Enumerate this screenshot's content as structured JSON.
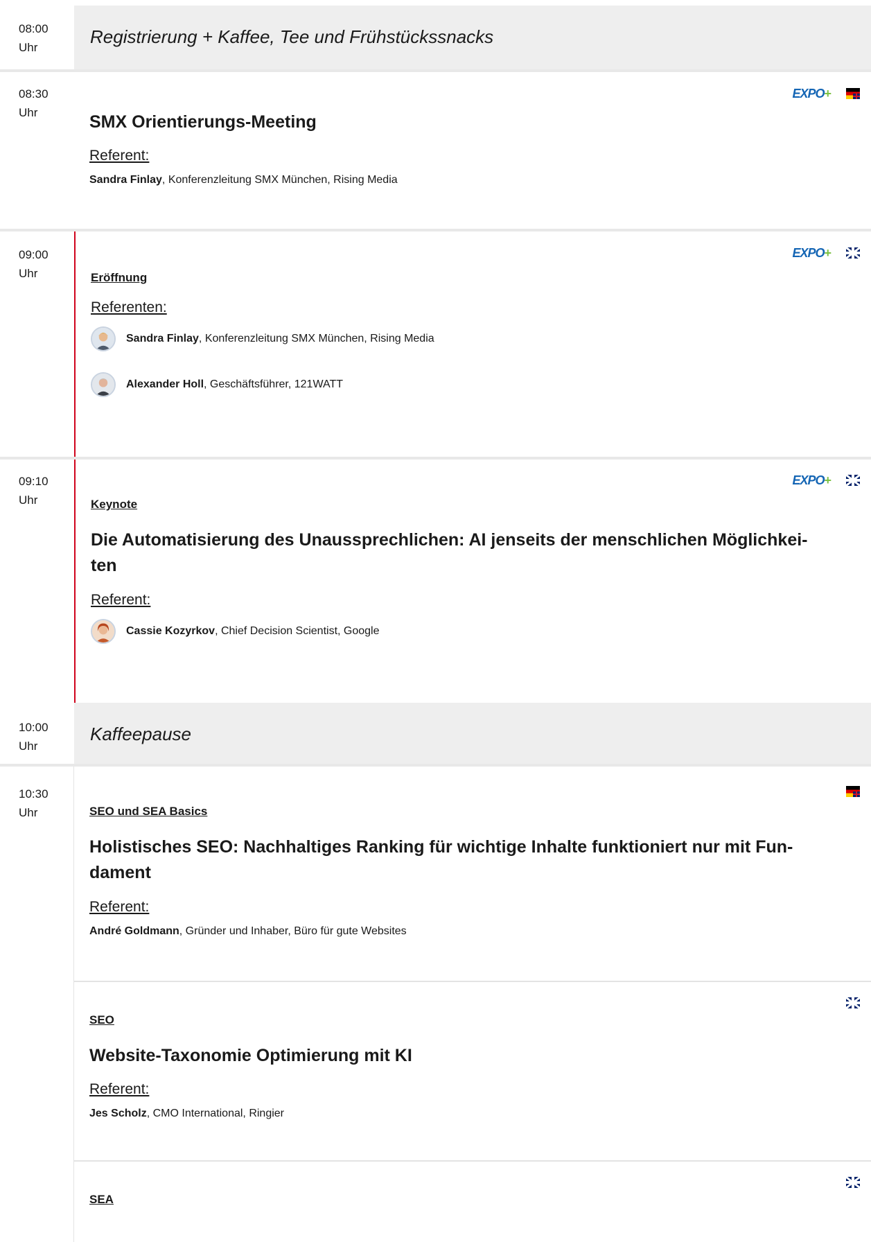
{
  "sessions": [
    {
      "time": "08:00",
      "unit": "Uhr",
      "break_title": "Registrierung + Kaffee, Tee und Frühstückssnacks"
    },
    {
      "time": "08:30",
      "unit": "Uhr",
      "expo_label": "EXPO",
      "expo_plus": "+",
      "title": "SMX Orientierungs-Meeting",
      "ref_label": "Referent:",
      "speakers": [
        {
          "name": "Sandra Finlay",
          "role": ", Konferenzleitung SMX München, Rising Media"
        }
      ]
    },
    {
      "time": "09:00",
      "unit": "Uhr",
      "expo_label": "EXPO",
      "expo_plus": "+",
      "track": "Eröffnung",
      "ref_label": "Referenten:",
      "speakers": [
        {
          "name": "Sandra Finlay",
          "role": ", Konferenzleitung SMX München, Rising Media"
        },
        {
          "name": "Alexander Holl",
          "role": ", Geschäftsführer, 121WATT"
        }
      ]
    },
    {
      "time": "09:10",
      "unit": "Uhr",
      "expo_label": "EXPO",
      "expo_plus": "+",
      "track": "Keynote",
      "title_line1": "Die Automatisierung des Unaussprechlichen: AI jenseits der menschlichen Möglichkei-",
      "title_line2": "ten",
      "ref_label": "Referent:",
      "speakers": [
        {
          "name": "Cassie Kozyrkov",
          "role": ", Chief Decision Scientist, Google"
        }
      ]
    },
    {
      "time": "10:00",
      "unit": "Uhr",
      "break_title": "Kaffeepause"
    },
    {
      "time": "10:30",
      "unit": "Uhr",
      "talks": [
        {
          "track": "SEO und SEA Basics",
          "title_line1": "Holistisches SEO: Nachhaltiges Ranking für wichtige Inhalte funktioniert nur mit Fun-",
          "title_line2": "dament",
          "ref_label": "Referent:",
          "speakers": [
            {
              "name": "André Goldmann",
              "role": ", Gründer und Inhaber, Büro für gute Websites"
            }
          ]
        },
        {
          "track": "SEO",
          "title": "Website-Taxonomie Optimierung mit KI",
          "ref_label": "Referent:",
          "speakers": [
            {
              "name": "Jes Scholz",
              "role": ", CMO International, Ringier"
            }
          ]
        },
        {
          "track": "SEA"
        }
      ]
    }
  ]
}
